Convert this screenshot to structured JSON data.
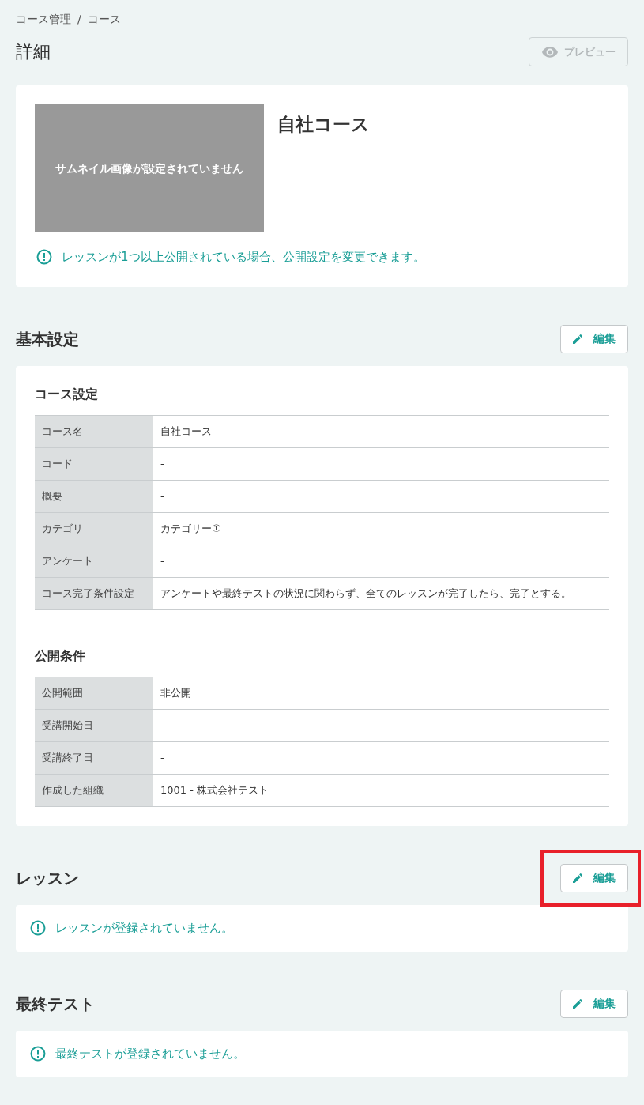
{
  "breadcrumb": {
    "items": [
      "コース管理",
      "コース"
    ],
    "separator": "/"
  },
  "page_title": "詳細",
  "preview_button": {
    "label": "プレビュー",
    "disabled": true
  },
  "course_card": {
    "thumbnail_text": "サムネイル画像が設定されていません",
    "title": "自社コース",
    "notice": "レッスンが1つ以上公開されている場合、公開設定を変更できます。"
  },
  "sections": [
    {
      "kind": "settings",
      "title": "基本設定",
      "edit_button": "編集",
      "highlighted": false,
      "groups": [
        {
          "title": "コース設定",
          "rows": [
            {
              "label": "コース名",
              "value": "自社コース"
            },
            {
              "label": "コード",
              "value": "-"
            },
            {
              "label": "概要",
              "value": "-"
            },
            {
              "label": "カテゴリ",
              "value": "カテゴリー①"
            },
            {
              "label": "アンケート",
              "value": "-"
            },
            {
              "label": "コース完了条件設定",
              "value": "アンケートや最終テストの状況に関わらず、全てのレッスンが完了したら、完了とする。"
            }
          ]
        },
        {
          "title": "公開条件",
          "rows": [
            {
              "label": "公開範囲",
              "value": "非公開"
            },
            {
              "label": "受講開始日",
              "value": "-"
            },
            {
              "label": "受講終了日",
              "value": "-"
            },
            {
              "label": "作成した組織",
              "value": "1001 - 株式会社テスト"
            }
          ]
        }
      ]
    },
    {
      "kind": "notice",
      "title": "レッスン",
      "edit_button": "編集",
      "highlighted": true,
      "message": "レッスンが登録されていません。"
    },
    {
      "kind": "notice",
      "title": "最終テスト",
      "edit_button": "編集",
      "highlighted": false,
      "message": "最終テストが登録されていません。"
    }
  ]
}
